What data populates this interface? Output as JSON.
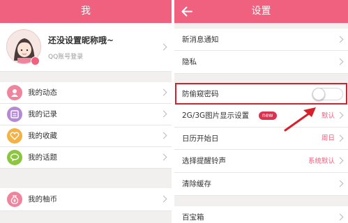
{
  "colors": {
    "accent": "#f0607f",
    "annotation": "#d9202a"
  },
  "left": {
    "header": {
      "title": "我"
    },
    "profile": {
      "nickname": "还没设置昵称哦~",
      "login_hint": "QQ账号登录"
    },
    "menu": [
      {
        "label": "我的动态",
        "icon": "activity-icon",
        "color": "#f0849d"
      },
      {
        "label": "我的记录",
        "icon": "record-icon",
        "color": "#b58ad4"
      },
      {
        "label": "我的收藏",
        "icon": "heart-icon",
        "color": "#f4b146"
      },
      {
        "label": "我的话题",
        "icon": "chat-icon",
        "color": "#8cc63f"
      },
      {
        "label": "我的柚币",
        "icon": "coin-bag-icon",
        "color": "#f0849d"
      }
    ]
  },
  "right": {
    "header": {
      "title": "设置",
      "back_icon": "back-arrow-icon"
    },
    "items": [
      {
        "label": "新消息通知"
      },
      {
        "label": "隐私"
      },
      {
        "label": "防偷窥密码",
        "toggle": false
      },
      {
        "label": "2G/3G图片显示设置",
        "badge": "new",
        "value": "默认"
      },
      {
        "label": "日历开始日",
        "value": "周日"
      },
      {
        "label": "选择提醒铃声",
        "value": "系统默认"
      },
      {
        "label": "清除缓存"
      },
      {
        "label": "百宝箱"
      }
    ]
  }
}
